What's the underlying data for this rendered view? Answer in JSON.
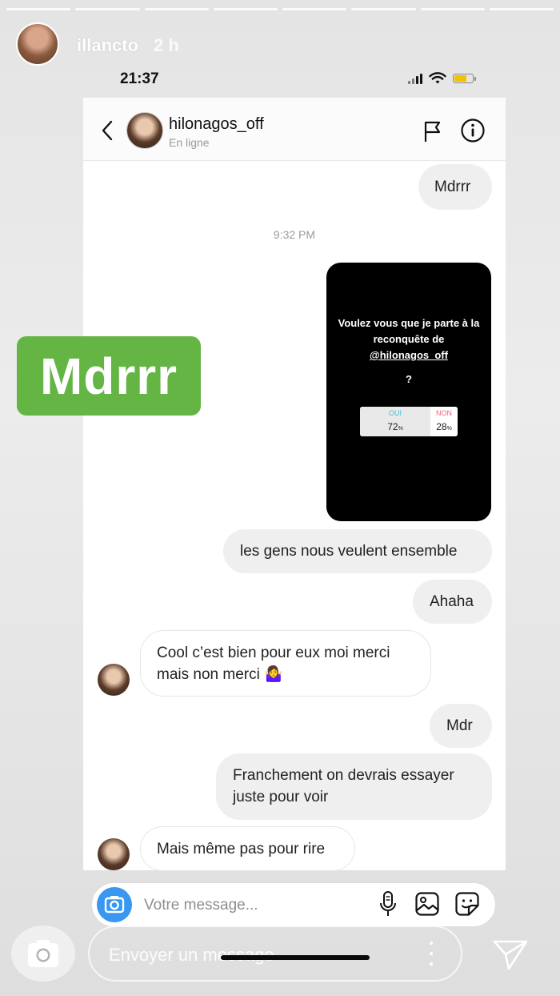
{
  "story": {
    "username": "illancto",
    "time_ago": "2 h",
    "segments": 8
  },
  "status_bar": {
    "time": "21:37",
    "battery_color": "#f2c200"
  },
  "chat": {
    "contact_name": "hilonagos_off",
    "contact_status": "En ligne"
  },
  "messages": [
    {
      "from": "me",
      "text": "Mdrrr"
    },
    {
      "from": "me",
      "text": "les gens nous veulent ensemble"
    },
    {
      "from": "me",
      "text": "Ahaha"
    },
    {
      "from": "them",
      "text": "Cool c’est bien pour eux moi merci mais non merci 🤷‍♀️"
    },
    {
      "from": "me",
      "text": "Mdr"
    },
    {
      "from": "me",
      "text": "Franchement on devrais essayer juste pour voir"
    },
    {
      "from": "them",
      "text": "Mais même pas pour rire"
    }
  ],
  "timestamp": "9:32 PM",
  "shared_story": {
    "text": "Voulez vous que je parte à la reconquête de",
    "mention": "@hilonagos_off",
    "question_mark": "?",
    "poll": {
      "option_a": {
        "label": "OUI",
        "percent": "72",
        "value": 0.72,
        "color": "#3ec8d1"
      },
      "option_b": {
        "label": "NON",
        "percent": "28",
        "value": 0.28,
        "color": "#e8667a"
      },
      "percent_sign": "%"
    }
  },
  "composer": {
    "placeholder": "Votre message..."
  },
  "sticker_text": "Mdrrr",
  "story_reply": {
    "placeholder": "Envoyer un message"
  },
  "colors": {
    "sticker_green": "#65b545",
    "camera_blue": "#3897f0"
  }
}
